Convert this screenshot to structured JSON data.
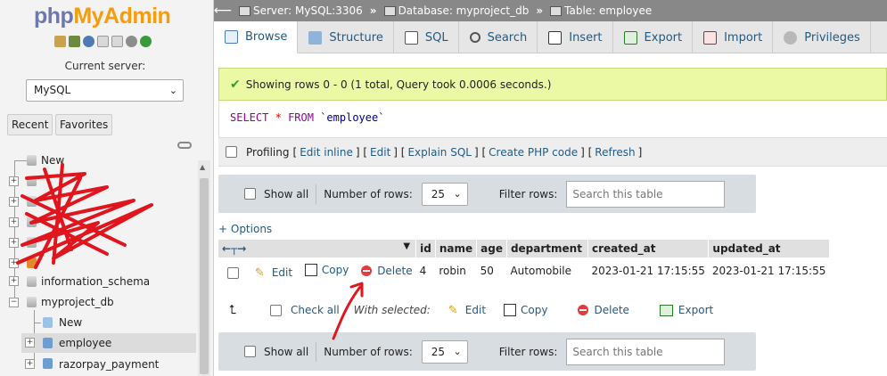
{
  "nav": {
    "logo_part1": "php",
    "logo_part2": "MyAdmin",
    "current_server_label": "Current server:",
    "server_value": "MySQL",
    "tab_recent": "Recent",
    "tab_favorites": "Favorites",
    "tree": {
      "new": "New",
      "information_schema": "information_schema",
      "myproject_db": "myproject_db",
      "db_new": "New",
      "employee": "employee",
      "razorpay_payment": "razorpay_payment"
    }
  },
  "breadcrumb": {
    "server": "Server: MySQL:3306",
    "database": "Database: myproject_db",
    "table": "Table: employee"
  },
  "tabs": [
    {
      "label": "Browse",
      "icon": "browse-icon"
    },
    {
      "label": "Structure",
      "icon": "structure-icon"
    },
    {
      "label": "SQL",
      "icon": "sql-icon"
    },
    {
      "label": "Search",
      "icon": "search-icon"
    },
    {
      "label": "Insert",
      "icon": "insert-icon"
    },
    {
      "label": "Export",
      "icon": "export-icon"
    },
    {
      "label": "Import",
      "icon": "import-icon"
    },
    {
      "label": "Privileges",
      "icon": "privileges-icon"
    }
  ],
  "message": "Showing rows 0 - 0 (1 total, Query took 0.0006 seconds.)",
  "sql": {
    "kw1": "SELECT",
    "star": "*",
    "kw2": "FROM",
    "table": "`employee`"
  },
  "profiling": {
    "label": "Profiling",
    "edit_inline": "Edit inline",
    "edit": "Edit",
    "explain": "Explain SQL",
    "create_php": "Create PHP code",
    "refresh": "Refresh"
  },
  "navbar": {
    "show_all": "Show all",
    "number_of_rows": "Number of rows:",
    "rows_value": "25",
    "filter_rows": "Filter rows:",
    "filter_placeholder": "Search this table"
  },
  "options_link": "+ Options",
  "table": {
    "columns": [
      "id",
      "name",
      "age",
      "department",
      "created_at",
      "updated_at"
    ],
    "rows": [
      {
        "edit": "Edit",
        "copy": "Copy",
        "delete": "Delete",
        "values": [
          "4",
          "robin",
          "50",
          "Automobile",
          "2023-01-21 17:15:55",
          "2023-01-21 17:15:55"
        ]
      }
    ]
  },
  "bulk": {
    "check_all": "Check all",
    "with_selected": "With selected:",
    "edit": "Edit",
    "copy": "Copy",
    "delete": "Delete",
    "export": "Export"
  },
  "colors": {
    "logo_php": "#6c78af",
    "logo_myadmin": "#f89c0e",
    "success_bg": "#ebf8a4",
    "link": "#235a81",
    "annotation_red": "#e0151d"
  }
}
